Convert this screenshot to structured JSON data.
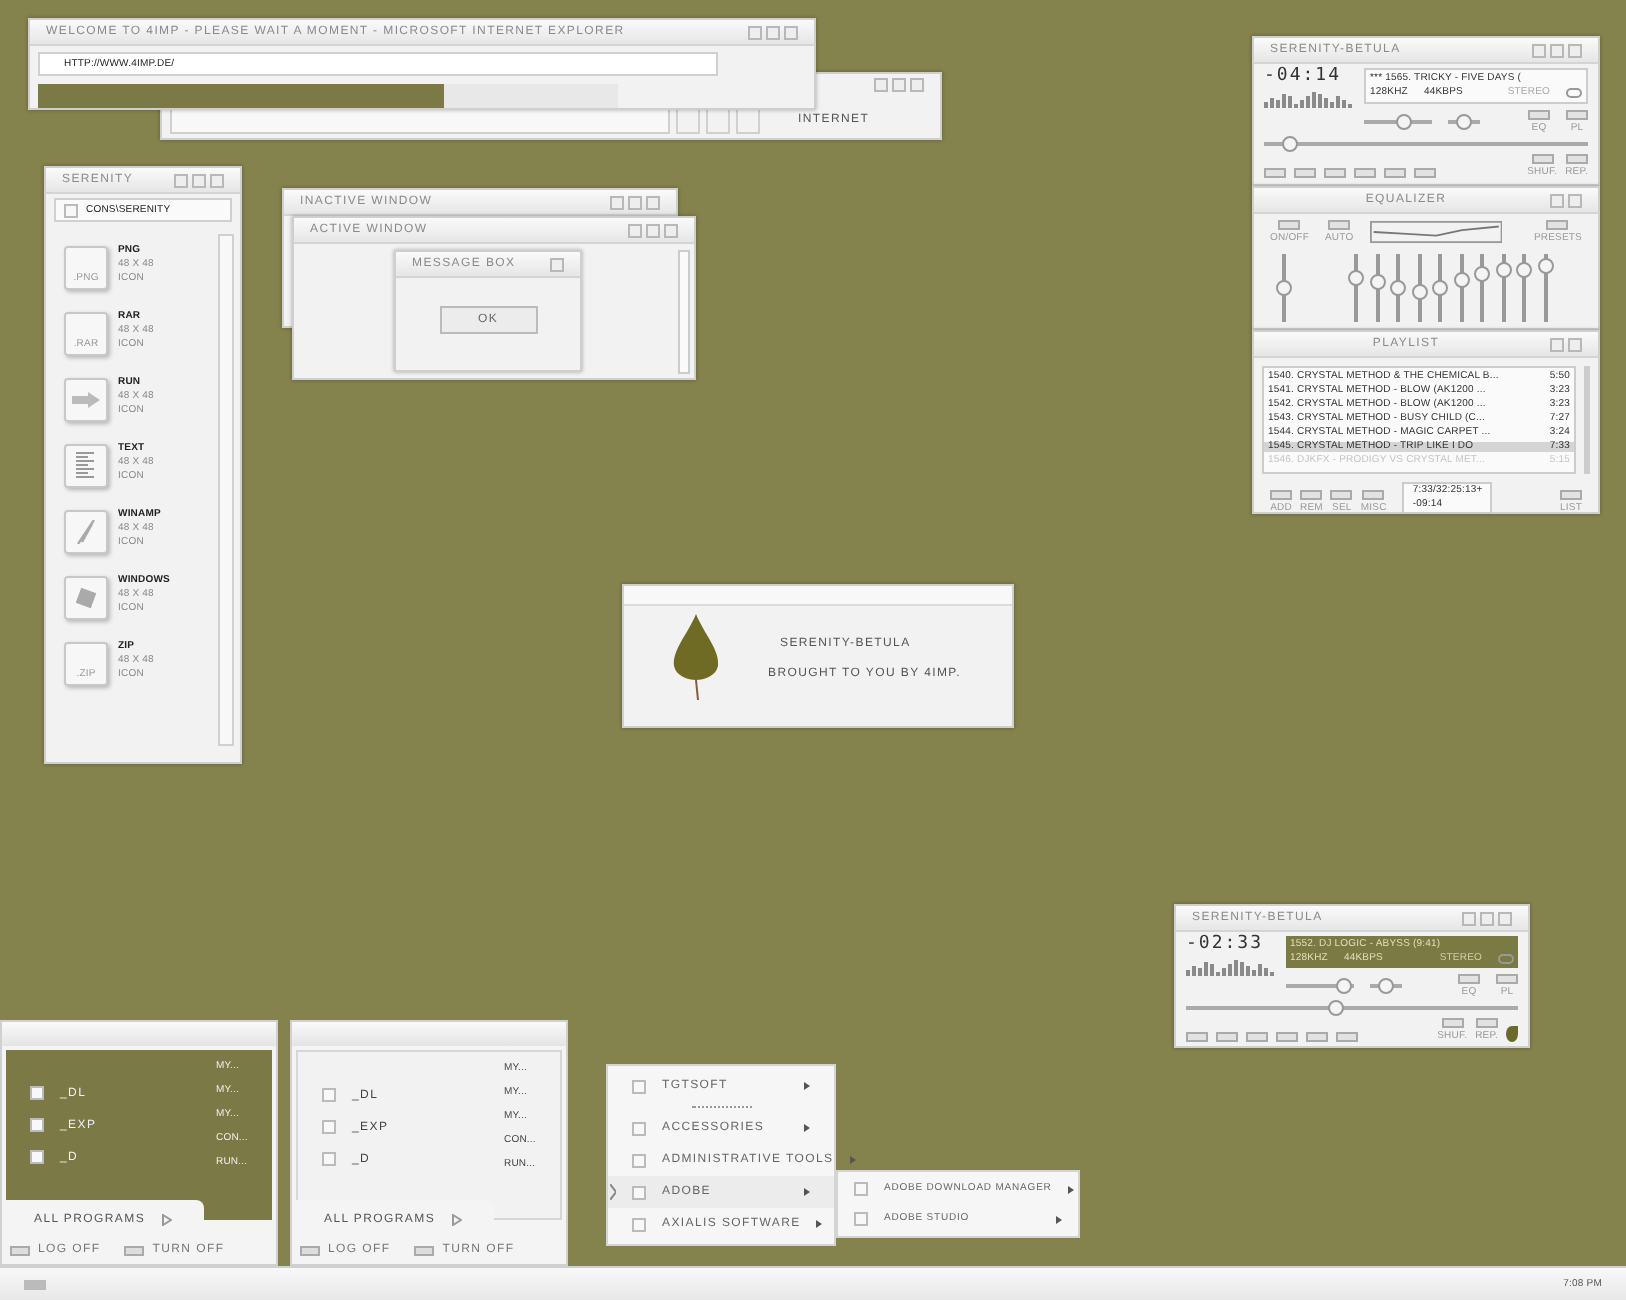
{
  "ie_window": {
    "title": "WELCOME TO 4IMP - PLEASE WAIT A MOMENT - MICROSOFT INTERNET EXPLORER",
    "address": "HTTP://WWW.4IMP.DE/",
    "progress": {
      "level": 0.7
    }
  },
  "ie_back_window": {
    "status": "INTERNET"
  },
  "explorer": {
    "title": "SERENITY",
    "path": "CONS\\SERENITY",
    "items": [
      {
        "name": "PNG",
        "size": "48 X 48",
        "type": "ICON",
        "kind": "file",
        "badge": ".PNG"
      },
      {
        "name": "RAR",
        "size": "48 X 48",
        "type": "ICON",
        "kind": "file",
        "badge": ".RAR"
      },
      {
        "name": "RUN",
        "size": "48 X 48",
        "type": "ICON",
        "kind": "arrow"
      },
      {
        "name": "TEXT",
        "size": "48 X 48",
        "type": "ICON",
        "kind": "text"
      },
      {
        "name": "WINAMP",
        "size": "48 X 48",
        "type": "ICON",
        "kind": "bolt"
      },
      {
        "name": "WINDOWS",
        "size": "48 X 48",
        "type": "ICON",
        "kind": "flag"
      },
      {
        "name": "ZIP",
        "size": "48 X 48",
        "type": "ICON",
        "kind": "file",
        "badge": ".ZIP"
      }
    ]
  },
  "inactive_window": {
    "title": "INACTIVE WINDOW"
  },
  "active_window": {
    "title": "ACTIVE WINDOW"
  },
  "message_box": {
    "title": "MESSAGE BOX",
    "button": "OK"
  },
  "player": {
    "title": "SERENITY-BETULA",
    "time": "-04:14",
    "track": "*** 1565. TRICKY - FIVE DAYS (",
    "khz": "128KHZ",
    "kbps": "44KBPS",
    "stereo": "STEREO",
    "eq": "EQ",
    "pl": "PL",
    "shuffle": "SHUF.",
    "repeat": "REP.",
    "seek": {
      "level": 0.08
    },
    "volume": {
      "level": 0.6
    },
    "balance": {
      "level": 0.5
    }
  },
  "equalizer": {
    "title": "EQUALIZER",
    "on_off": "ON/OFF",
    "auto": "AUTO",
    "presets": "PRESETS",
    "preamp": {
      "level": 0.51
    },
    "bands": [
      {
        "level": 0.65
      },
      {
        "level": 0.58
      },
      {
        "level": 0.49
      },
      {
        "level": 0.44
      },
      {
        "level": 0.49
      },
      {
        "level": 0.62
      },
      {
        "level": 0.71
      },
      {
        "level": 0.76
      },
      {
        "level": 0.77
      },
      {
        "level": 0.81
      }
    ]
  },
  "playlist": {
    "title": "PLAYLIST",
    "rows": [
      {
        "text": "1540. CRYSTAL METHOD & THE CHEMICAL B...",
        "time": "5:50",
        "selected": false,
        "disabled": false
      },
      {
        "text": "1541. CRYSTAL METHOD - BLOW (AK1200 ...",
        "time": "3:23",
        "selected": false,
        "disabled": false
      },
      {
        "text": "1542. CRYSTAL METHOD - BLOW (AK1200 ...",
        "time": "3:23",
        "selected": false,
        "disabled": false
      },
      {
        "text": "1543. CRYSTAL METHOD - BUSY CHILD (C...",
        "time": "7:27",
        "selected": false,
        "disabled": false
      },
      {
        "text": "1544. CRYSTAL METHOD - MAGIC CARPET ...",
        "time": "3:24",
        "selected": false,
        "disabled": false
      },
      {
        "text": "1545. CRYSTAL METHOD - TRIP LIKE I DO",
        "time": "7:33",
        "selected": true,
        "disabled": false
      },
      {
        "text": "1546. DJKFX - PRODIGY VS CRYSTAL MET...",
        "time": "5:15",
        "selected": false,
        "disabled": true
      }
    ],
    "buttons": [
      "ADD",
      "REM",
      "SEL",
      "MISC"
    ],
    "list_button": "LIST",
    "total": "7:33/32:25:13+",
    "remaining": "-09:14"
  },
  "splash": {
    "title": "SERENITY-BETULA",
    "subtitle": "BROUGHT TO YOU BY 4IMP."
  },
  "mini_player": {
    "title": "SERENITY-BETULA",
    "time": "-02:33",
    "track": "1552. DJ LOGIC - ABYSS (9:41)",
    "khz": "128KHZ",
    "kbps": "44KBPS",
    "stereo": "STEREO",
    "eq": "EQ",
    "pl": "PL",
    "shuffle": "SHUF.",
    "repeat": "REP.",
    "seek": {
      "level": 0.45
    },
    "volume": {
      "level": 0.85
    },
    "balance": {
      "level": 0.5
    }
  },
  "start_menus": [
    {
      "left_items": [
        "_DL",
        "_EXP",
        "_D"
      ],
      "right_items": [
        "MY...",
        "MY...",
        "MY...",
        "CON...",
        "RUN..."
      ],
      "all_programs": "ALL PROGRAMS",
      "log_off": "LOG OFF",
      "turn_off": "TURN OFF"
    },
    {
      "left_items": [
        "_DL",
        "_EXP",
        "_D"
      ],
      "right_items": [
        "MY...",
        "MY...",
        "MY...",
        "CON...",
        "RUN..."
      ],
      "all_programs": "ALL PROGRAMS",
      "log_off": "LOG OFF",
      "turn_off": "TURN OFF"
    }
  ],
  "programs_menu": {
    "items": [
      {
        "kind": "item",
        "label": "TGTSOFT",
        "selected": false
      },
      {
        "kind": "separator"
      },
      {
        "kind": "item",
        "label": "ACCESSORIES",
        "selected": false
      },
      {
        "kind": "item",
        "label": "ADMINISTRATIVE TOOLS",
        "selected": false
      },
      {
        "kind": "item",
        "label": "ADOBE",
        "selected": true
      },
      {
        "kind": "item",
        "label": "AXIALIS SOFTWARE",
        "selected": false
      }
    ],
    "submenu": [
      "ADOBE DOWNLOAD MANAGER",
      "ADOBE STUDIO"
    ]
  },
  "taskbar": {
    "clock": "7:08 PM"
  }
}
